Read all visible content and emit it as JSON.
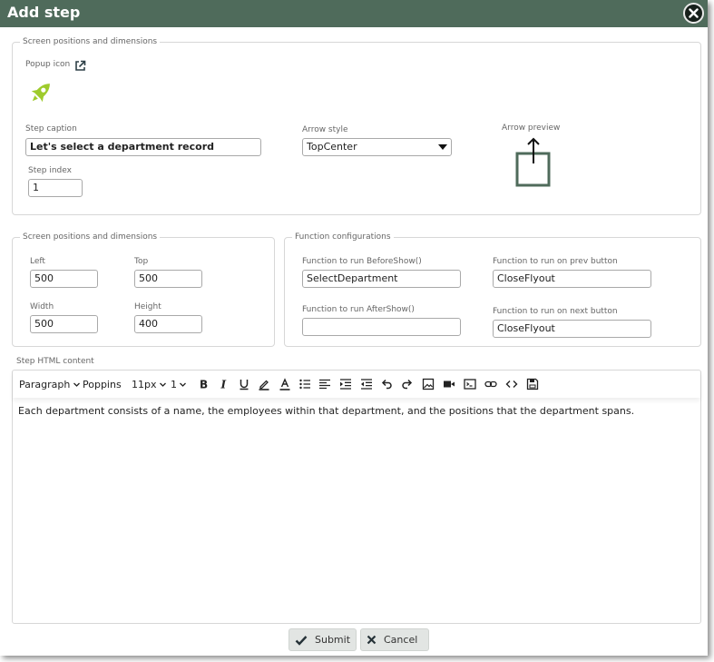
{
  "dialog": {
    "title": "Add step",
    "close_icon": "close-icon",
    "accent_color": "#4f6b5b"
  },
  "step_section": {
    "legend": "Screen positions and dimensions",
    "popup_icon_label": "Popup icon",
    "popup_icon_link_icon": "external-link-icon",
    "popup_icon_preview": "rocket-icon",
    "step_caption_label": "Step caption",
    "step_caption_value": "Let's select a department record",
    "arrow_style_label": "Arrow style",
    "arrow_style_value": "TopCenter",
    "arrow_preview_label": "Arrow preview",
    "step_index_label": "Step index",
    "step_index_value": "1"
  },
  "position_section": {
    "legend": "Screen positions and dimensions",
    "left_label": "Left",
    "left_value": "500",
    "top_label": "Top",
    "top_value": "500",
    "width_label": "Width",
    "width_value": "500",
    "height_label": "Height",
    "height_value": "400"
  },
  "function_section": {
    "legend": "Function configurations",
    "before_show_label": "Function to run BeforeShow()",
    "before_show_value": "SelectDepartment",
    "after_show_label": "Function to run AfterShow()",
    "after_show_value": "",
    "prev_label": "Function to run on prev button",
    "prev_value": "CloseFlyout",
    "next_label": "Function to run on next button",
    "next_value": "CloseFlyout"
  },
  "editor": {
    "label": "Step HTML content",
    "block_format": "Paragraph",
    "font_family": "Poppins",
    "font_size": "11px",
    "line_height": "1",
    "toolbar_icons": [
      "bold-icon",
      "italic-icon",
      "underline-icon",
      "highlight-icon",
      "font-color-icon",
      "bullet-list-icon",
      "align-left-icon",
      "indent-icon",
      "outdent-icon",
      "undo-icon",
      "redo-icon",
      "image-icon",
      "video-icon",
      "code-view-icon",
      "link-icon",
      "source-code-icon",
      "save-icon"
    ],
    "content": "Each department consists of a name, the employees within that department, and the positions that the department spans."
  },
  "footer": {
    "submit_label": "Submit",
    "cancel_label": "Cancel"
  }
}
